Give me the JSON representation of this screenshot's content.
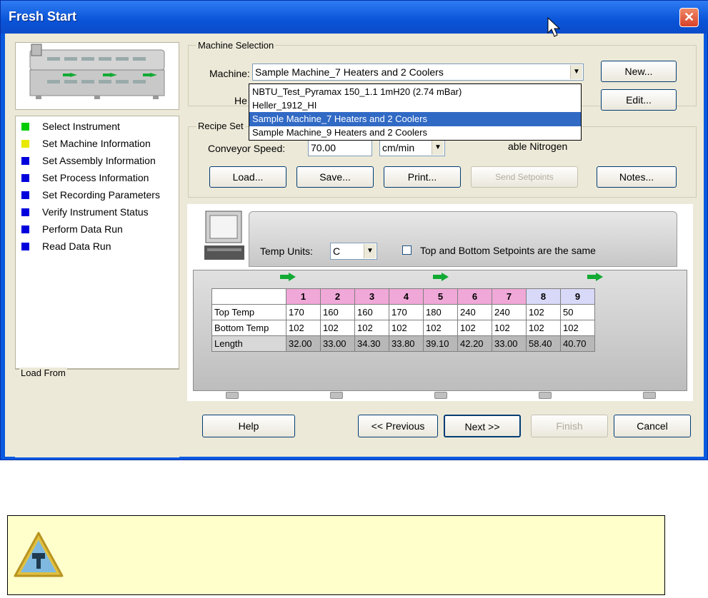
{
  "window": {
    "title": "Fresh Start",
    "close_glyph": "✕"
  },
  "steps": [
    {
      "label": "Select Instrument",
      "color": "#00cc00"
    },
    {
      "label": "Set Machine Information",
      "color": "#e8e800"
    },
    {
      "label": "Set Assembly Information",
      "color": "#0000dd"
    },
    {
      "label": "Set Process Information",
      "color": "#0000dd"
    },
    {
      "label": "Set Recording Parameters",
      "color": "#0000dd"
    },
    {
      "label": "Verify Instrument Status",
      "color": "#0000dd"
    },
    {
      "label": "Perform Data Run",
      "color": "#0000dd"
    },
    {
      "label": "Read Data Run",
      "color": "#0000dd"
    }
  ],
  "load_from": {
    "label": "Load From"
  },
  "machine_selection": {
    "group_label": "Machine Selection",
    "machine_label": "Machine:",
    "heater_label": "He",
    "machine_value": "Sample Machine_7 Heaters and 2 Coolers",
    "new_button": "New...",
    "edit_button": "Edit...",
    "dropdown_options": [
      "NBTU_Test_Pyramax 150_1.1 1mH20 (2.74 mBar)",
      "Heller_1912_HI",
      "Sample Machine_7 Heaters and 2 Coolers",
      "Sample Machine_9 Heaters and 2 Coolers"
    ],
    "selected_index": 2
  },
  "recipe": {
    "group_label": "Recipe Set",
    "conveyor_label": "Conveyor Speed:",
    "conveyor_value": "70.00",
    "conveyor_units": "cm/min",
    "nitrogen_label": "able Nitrogen",
    "buttons": {
      "load": "Load...",
      "save": "Save...",
      "print": "Print...",
      "send": "Send Setpoints",
      "notes": "Notes..."
    }
  },
  "oven": {
    "temp_units_label": "Temp Units:",
    "temp_units_value": "C",
    "same_setpoints_label": "Top and Bottom Setpoints are the same",
    "same_setpoints_checked": false,
    "zones": [
      {
        "label": "1",
        "kind": "heater"
      },
      {
        "label": "2",
        "kind": "heater"
      },
      {
        "label": "3",
        "kind": "heater"
      },
      {
        "label": "4",
        "kind": "heater"
      },
      {
        "label": "5",
        "kind": "heater"
      },
      {
        "label": "6",
        "kind": "heater"
      },
      {
        "label": "7",
        "kind": "heater"
      },
      {
        "label": "8",
        "kind": "cooler"
      },
      {
        "label": "9",
        "kind": "cooler"
      }
    ],
    "rows": [
      {
        "label": "Top Temp",
        "values": [
          "170",
          "160",
          "160",
          "170",
          "180",
          "240",
          "240",
          "102",
          "50"
        ]
      },
      {
        "label": "Bottom Temp",
        "values": [
          "102",
          "102",
          "102",
          "102",
          "102",
          "102",
          "102",
          "102",
          "102"
        ]
      },
      {
        "label": "Length",
        "values": [
          "32.00",
          "33.00",
          "34.30",
          "33.80",
          "39.10",
          "42.20",
          "33.00",
          "58.40",
          "40.70"
        ]
      }
    ]
  },
  "footer": {
    "help": "Help",
    "previous": "<< Previous",
    "next": "Next >>",
    "finish": "Finish",
    "cancel": "Cancel"
  },
  "colors": {
    "title_bar": "#0a54d8",
    "heater_zone": "#f0a8d8",
    "cooler_zone": "#d8d8f8",
    "selection": "#316ac5",
    "note_bg": "#ffffcc"
  },
  "note": {
    "icon": "caution-icon"
  }
}
